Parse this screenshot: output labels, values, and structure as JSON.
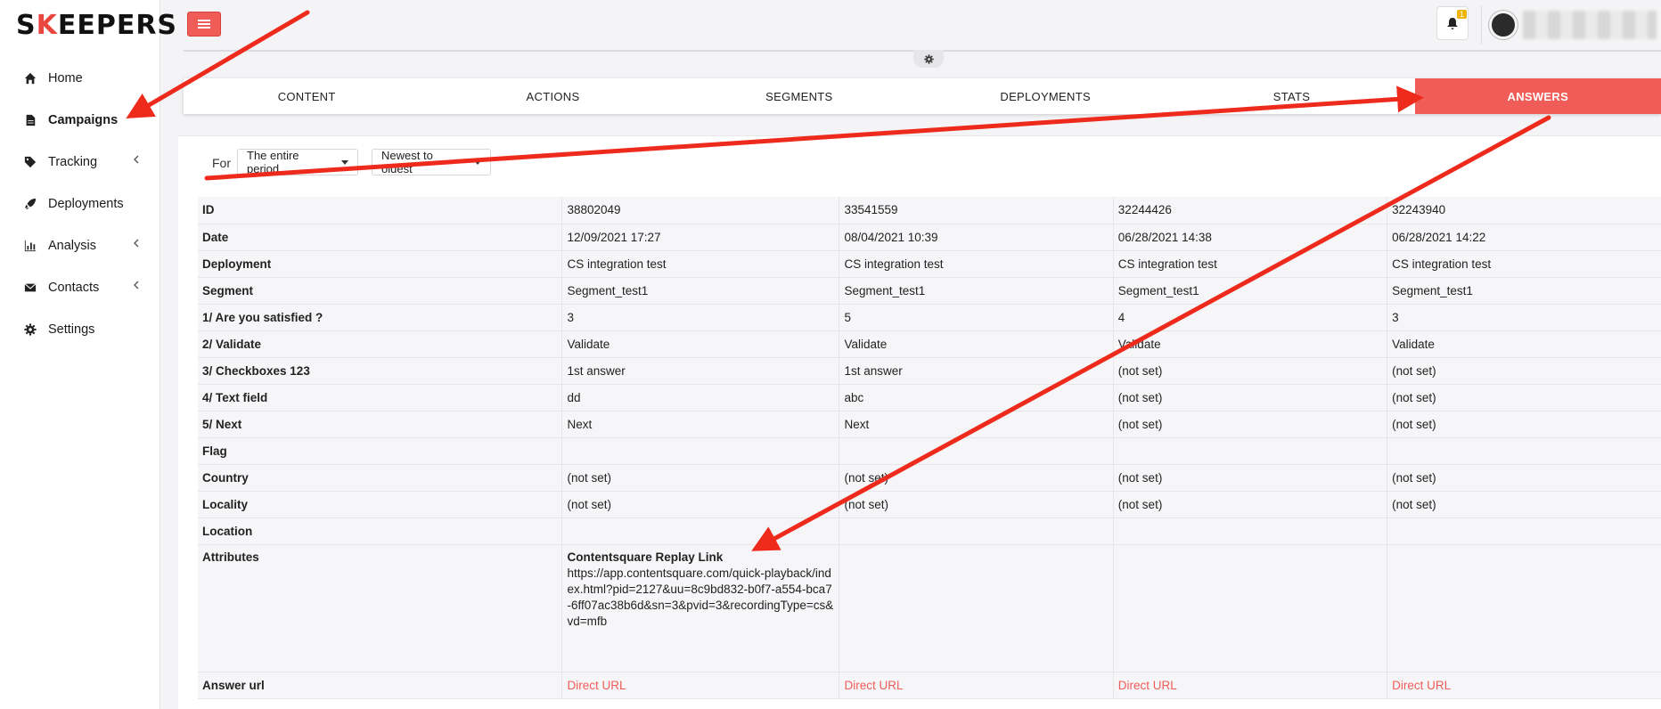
{
  "logo": {
    "text_pre": "S",
    "text_k": "K",
    "text_post": "EEPERS"
  },
  "sidebar": {
    "items": [
      {
        "label": "Home",
        "icon": "home-icon"
      },
      {
        "label": "Campaigns",
        "icon": "file-icon",
        "active": true
      },
      {
        "label": "Tracking",
        "icon": "tag-icon",
        "has_submenu": true
      },
      {
        "label": "Deployments",
        "icon": "rocket-icon"
      },
      {
        "label": "Analysis",
        "icon": "bar-chart-icon",
        "has_submenu": true
      },
      {
        "label": "Contacts",
        "icon": "envelope-icon",
        "has_submenu": true
      },
      {
        "label": "Settings",
        "icon": "gear-icon"
      }
    ]
  },
  "header": {
    "notification_count": "1"
  },
  "tabs": [
    {
      "label": "CONTENT"
    },
    {
      "label": "ACTIONS"
    },
    {
      "label": "SEGMENTS"
    },
    {
      "label": "DEPLOYMENTS"
    },
    {
      "label": "STATS"
    },
    {
      "label": "ANSWERS",
      "active": true
    }
  ],
  "filters": {
    "for_label": "For",
    "period": "The entire period",
    "order": "Newest to oldest"
  },
  "table": {
    "rows": [
      {
        "label": "ID",
        "values": [
          "38802049",
          "33541559",
          "32244426",
          "32243940"
        ]
      },
      {
        "label": "Date",
        "values": [
          "12/09/2021 17:27",
          "08/04/2021 10:39",
          "06/28/2021 14:38",
          "06/28/2021 14:22"
        ]
      },
      {
        "label": "Deployment",
        "values": [
          "CS integration test",
          "CS integration test",
          "CS integration test",
          "CS integration test"
        ]
      },
      {
        "label": "Segment",
        "values": [
          "Segment_test1",
          "Segment_test1",
          "Segment_test1",
          "Segment_test1"
        ]
      },
      {
        "label": "1/ Are you satisfied ?",
        "values": [
          "3",
          "5",
          "4",
          "3"
        ]
      },
      {
        "label": "2/ Validate",
        "values": [
          "Validate",
          "Validate",
          "Validate",
          "Validate"
        ]
      },
      {
        "label": "3/ Checkboxes 123",
        "values": [
          "1st answer",
          "1st answer",
          "(not set)",
          "(not set)"
        ]
      },
      {
        "label": "4/ Text field",
        "values": [
          "dd",
          "abc",
          "(not set)",
          "(not set)"
        ]
      },
      {
        "label": "5/ Next",
        "values": [
          "Next",
          "Next",
          "(not set)",
          "(not set)"
        ]
      },
      {
        "label": "Flag",
        "values": [
          "",
          "",
          "",
          ""
        ]
      },
      {
        "label": "Country",
        "values": [
          "(not set)",
          "(not set)",
          "(not set)",
          "(not set)"
        ]
      },
      {
        "label": "Locality",
        "values": [
          "(not set)",
          "(not set)",
          "(not set)",
          "(not set)"
        ]
      },
      {
        "label": "Location",
        "values": [
          "",
          "",
          "",
          ""
        ]
      }
    ],
    "attributes": {
      "label": "Attributes",
      "title": "Contentsquare Replay Link",
      "link": "https://app.contentsquare.com/quick-playback/index.html?pid=2127&uu=8c9bd832-b0f7-a554-bca7-6ff07ac38b6d&sn=3&pvid=3&recordingType=cs&vd=mfb"
    },
    "answer_url": {
      "label": "Answer url",
      "link_text": "Direct URL"
    }
  },
  "colors": {
    "accent": "#f05c57",
    "arrow": "#ee2a1c"
  }
}
